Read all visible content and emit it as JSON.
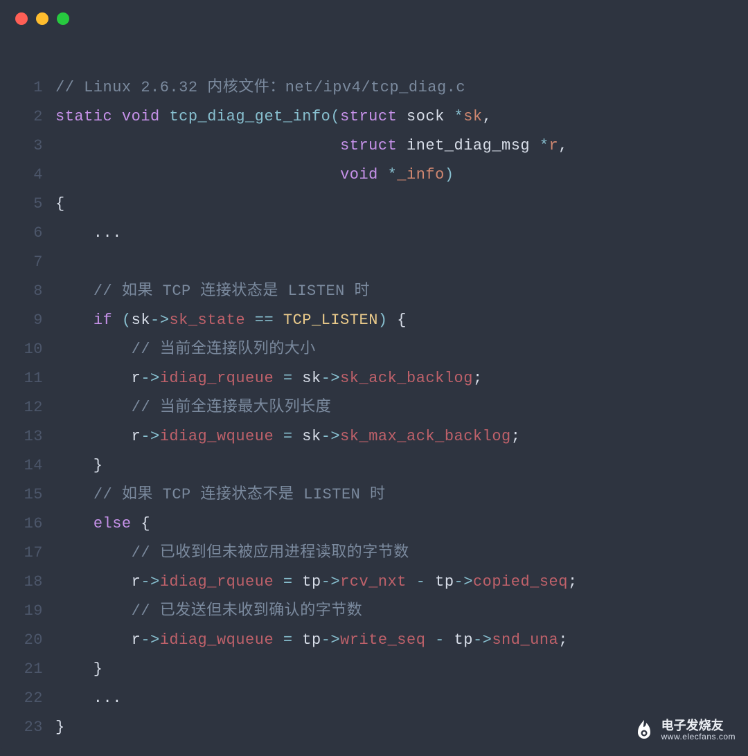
{
  "window": {
    "dots": [
      "red",
      "yellow",
      "green"
    ]
  },
  "code": {
    "lines": [
      {
        "n": 1,
        "tokens": [
          {
            "t": "// Linux 2.6.32 内核文件：net/ipv4/tcp_diag.c",
            "c": "c-comment"
          }
        ]
      },
      {
        "n": 2,
        "tokens": [
          {
            "t": "static",
            "c": "c-keyword"
          },
          {
            "t": " ",
            "c": "c-text"
          },
          {
            "t": "void",
            "c": "c-type"
          },
          {
            "t": " ",
            "c": "c-text"
          },
          {
            "t": "tcp_diag_get_info",
            "c": "c-func"
          },
          {
            "t": "(",
            "c": "c-punct"
          },
          {
            "t": "struct",
            "c": "c-keyword"
          },
          {
            "t": " ",
            "c": "c-text"
          },
          {
            "t": "sock",
            "c": "c-text"
          },
          {
            "t": " ",
            "c": "c-text"
          },
          {
            "t": "*",
            "c": "c-star"
          },
          {
            "t": "sk",
            "c": "c-param"
          },
          {
            "t": ",",
            "c": "c-text"
          }
        ]
      },
      {
        "n": 3,
        "tokens": [
          {
            "t": "                              ",
            "c": "c-text"
          },
          {
            "t": "struct",
            "c": "c-keyword"
          },
          {
            "t": " ",
            "c": "c-text"
          },
          {
            "t": "inet_diag_msg",
            "c": "c-text"
          },
          {
            "t": " ",
            "c": "c-text"
          },
          {
            "t": "*",
            "c": "c-star"
          },
          {
            "t": "r",
            "c": "c-param"
          },
          {
            "t": ",",
            "c": "c-text"
          }
        ]
      },
      {
        "n": 4,
        "tokens": [
          {
            "t": "                              ",
            "c": "c-text"
          },
          {
            "t": "void",
            "c": "c-type"
          },
          {
            "t": " ",
            "c": "c-text"
          },
          {
            "t": "*",
            "c": "c-star"
          },
          {
            "t": "_info",
            "c": "c-param"
          },
          {
            "t": ")",
            "c": "c-punct"
          }
        ]
      },
      {
        "n": 5,
        "tokens": [
          {
            "t": "{",
            "c": "c-text"
          }
        ]
      },
      {
        "n": 6,
        "tokens": [
          {
            "t": "    ...",
            "c": "c-text"
          }
        ]
      },
      {
        "n": 7,
        "tokens": [
          {
            "t": "",
            "c": "c-text"
          }
        ]
      },
      {
        "n": 8,
        "tokens": [
          {
            "t": "    ",
            "c": "c-text"
          },
          {
            "t": "// 如果 TCP 连接状态是 LISTEN 时",
            "c": "c-comment"
          }
        ]
      },
      {
        "n": 9,
        "tokens": [
          {
            "t": "    ",
            "c": "c-text"
          },
          {
            "t": "if",
            "c": "c-keyword"
          },
          {
            "t": " ",
            "c": "c-text"
          },
          {
            "t": "(",
            "c": "c-punct"
          },
          {
            "t": "sk",
            "c": "c-var"
          },
          {
            "t": "->",
            "c": "c-arrow"
          },
          {
            "t": "sk_state",
            "c": "c-member"
          },
          {
            "t": " == ",
            "c": "c-op"
          },
          {
            "t": "TCP_LISTEN",
            "c": "c-const"
          },
          {
            "t": ")",
            "c": "c-punct"
          },
          {
            "t": " {",
            "c": "c-text"
          }
        ]
      },
      {
        "n": 10,
        "tokens": [
          {
            "t": "        ",
            "c": "c-text"
          },
          {
            "t": "// 当前全连接队列的大小",
            "c": "c-comment"
          }
        ]
      },
      {
        "n": 11,
        "tokens": [
          {
            "t": "        ",
            "c": "c-text"
          },
          {
            "t": "r",
            "c": "c-var"
          },
          {
            "t": "->",
            "c": "c-arrow"
          },
          {
            "t": "idiag_rqueue",
            "c": "c-member"
          },
          {
            "t": " = ",
            "c": "c-assign"
          },
          {
            "t": "sk",
            "c": "c-var"
          },
          {
            "t": "->",
            "c": "c-arrow"
          },
          {
            "t": "sk_ack_backlog",
            "c": "c-member"
          },
          {
            "t": ";",
            "c": "c-text"
          }
        ]
      },
      {
        "n": 12,
        "tokens": [
          {
            "t": "        ",
            "c": "c-text"
          },
          {
            "t": "// 当前全连接最大队列长度",
            "c": "c-comment"
          }
        ]
      },
      {
        "n": 13,
        "tokens": [
          {
            "t": "        ",
            "c": "c-text"
          },
          {
            "t": "r",
            "c": "c-var"
          },
          {
            "t": "->",
            "c": "c-arrow"
          },
          {
            "t": "idiag_wqueue",
            "c": "c-member"
          },
          {
            "t": " = ",
            "c": "c-assign"
          },
          {
            "t": "sk",
            "c": "c-var"
          },
          {
            "t": "->",
            "c": "c-arrow"
          },
          {
            "t": "sk_max_ack_backlog",
            "c": "c-member"
          },
          {
            "t": ";",
            "c": "c-text"
          }
        ]
      },
      {
        "n": 14,
        "tokens": [
          {
            "t": "    }",
            "c": "c-text"
          }
        ]
      },
      {
        "n": 15,
        "tokens": [
          {
            "t": "    ",
            "c": "c-text"
          },
          {
            "t": "// 如果 TCP 连接状态不是 LISTEN 时",
            "c": "c-comment"
          }
        ]
      },
      {
        "n": 16,
        "tokens": [
          {
            "t": "    ",
            "c": "c-text"
          },
          {
            "t": "else",
            "c": "c-keyword"
          },
          {
            "t": " {",
            "c": "c-text"
          }
        ]
      },
      {
        "n": 17,
        "tokens": [
          {
            "t": "        ",
            "c": "c-text"
          },
          {
            "t": "// 已收到但未被应用进程读取的字节数",
            "c": "c-comment"
          }
        ]
      },
      {
        "n": 18,
        "tokens": [
          {
            "t": "        ",
            "c": "c-text"
          },
          {
            "t": "r",
            "c": "c-var"
          },
          {
            "t": "->",
            "c": "c-arrow"
          },
          {
            "t": "idiag_rqueue",
            "c": "c-member"
          },
          {
            "t": " = ",
            "c": "c-assign"
          },
          {
            "t": "tp",
            "c": "c-var"
          },
          {
            "t": "->",
            "c": "c-arrow"
          },
          {
            "t": "rcv_nxt",
            "c": "c-member"
          },
          {
            "t": " - ",
            "c": "c-op"
          },
          {
            "t": "tp",
            "c": "c-var"
          },
          {
            "t": "->",
            "c": "c-arrow"
          },
          {
            "t": "copied_seq",
            "c": "c-member"
          },
          {
            "t": ";",
            "c": "c-text"
          }
        ]
      },
      {
        "n": 19,
        "tokens": [
          {
            "t": "        ",
            "c": "c-text"
          },
          {
            "t": "// 已发送但未收到确认的字节数",
            "c": "c-comment"
          }
        ]
      },
      {
        "n": 20,
        "tokens": [
          {
            "t": "        ",
            "c": "c-text"
          },
          {
            "t": "r",
            "c": "c-var"
          },
          {
            "t": "->",
            "c": "c-arrow"
          },
          {
            "t": "idiag_wqueue",
            "c": "c-member"
          },
          {
            "t": " = ",
            "c": "c-assign"
          },
          {
            "t": "tp",
            "c": "c-var"
          },
          {
            "t": "->",
            "c": "c-arrow"
          },
          {
            "t": "write_seq",
            "c": "c-member"
          },
          {
            "t": " - ",
            "c": "c-op"
          },
          {
            "t": "tp",
            "c": "c-var"
          },
          {
            "t": "->",
            "c": "c-arrow"
          },
          {
            "t": "snd_una",
            "c": "c-member"
          },
          {
            "t": ";",
            "c": "c-text"
          }
        ]
      },
      {
        "n": 21,
        "tokens": [
          {
            "t": "    }",
            "c": "c-text"
          }
        ]
      },
      {
        "n": 22,
        "tokens": [
          {
            "t": "    ...",
            "c": "c-text"
          }
        ]
      },
      {
        "n": 23,
        "tokens": [
          {
            "t": "}",
            "c": "c-text"
          }
        ]
      }
    ]
  },
  "watermark": {
    "title": "电子发烧友",
    "url": "www.elecfans.com"
  }
}
